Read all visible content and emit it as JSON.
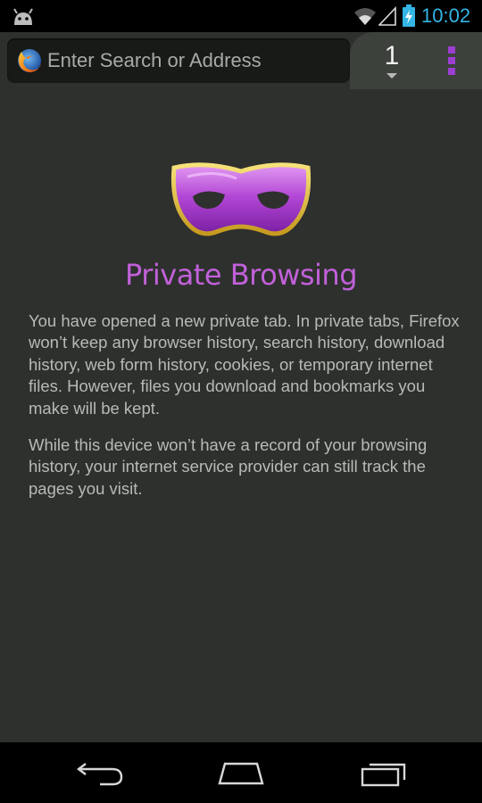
{
  "status_bar": {
    "time": "10:02",
    "colors": {
      "accent": "#33b5e5"
    },
    "icons": [
      "android-icon",
      "wifi-icon",
      "signal-icon",
      "battery-charging-icon"
    ]
  },
  "toolbar": {
    "url_placeholder": "Enter Search or Address",
    "tab_count": "1",
    "icons": [
      "firefox-icon",
      "menu-icon"
    ]
  },
  "main": {
    "title": "Private Browsing",
    "paragraphs": [
      "You have opened a new private tab. In private tabs, Firefox won’t keep any browser history, search history, download history, web form history, cookies, or temporary internet files. However, files you download and bookmarks you make will be kept.",
      "While this device won’t have a record of your browsing history, your internet service provider can still track the pages you visit."
    ],
    "colors": {
      "title": "#c161d9",
      "background": "#2e302d",
      "text": "#b8bab6"
    },
    "icons": [
      "mask-icon"
    ]
  },
  "nav_bar": {
    "icons": [
      "back-icon",
      "home-icon",
      "recents-icon"
    ]
  }
}
